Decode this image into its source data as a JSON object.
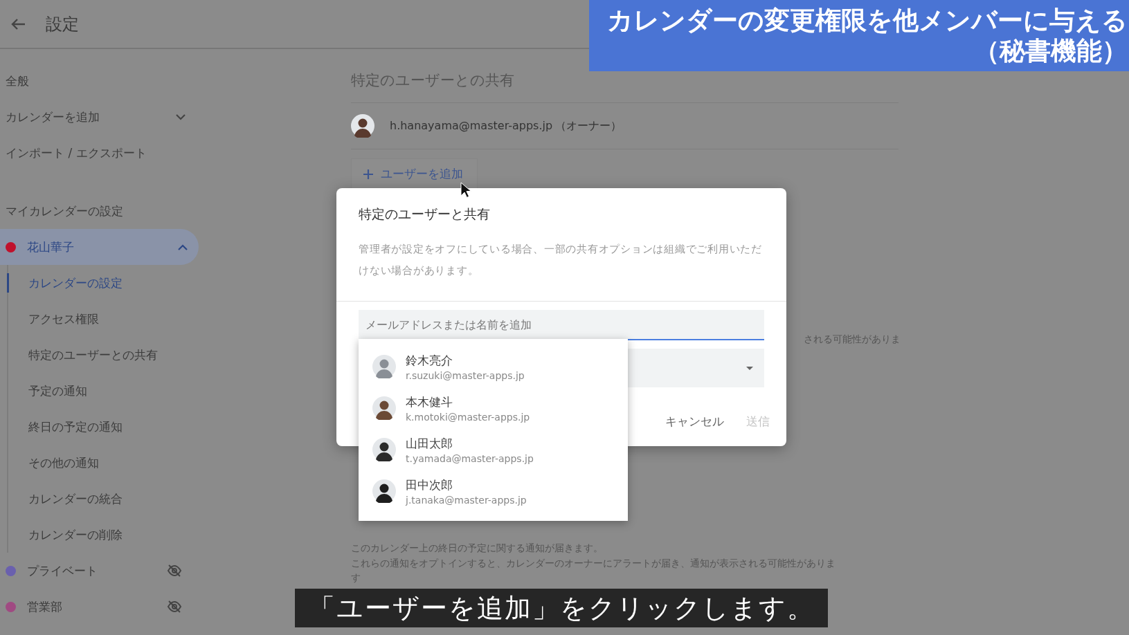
{
  "header": {
    "title": "設定"
  },
  "sidebar": {
    "items": [
      {
        "label": "全般",
        "kind": "link"
      },
      {
        "label": "カレンダーを追加",
        "kind": "expander",
        "expanded": false
      },
      {
        "label": "インポート / エクスポート",
        "kind": "link"
      }
    ],
    "section_title": "マイカレンダーの設定",
    "calendars": [
      {
        "name": "花山華子",
        "color": "#c0112c",
        "selected": true,
        "expanded": true,
        "hidden": false,
        "children": [
          {
            "label": "カレンダーの設定",
            "selected": true
          },
          {
            "label": "アクセス権限",
            "selected": false
          },
          {
            "label": "特定のユーザーとの共有",
            "selected": false
          },
          {
            "label": "予定の通知",
            "selected": false
          },
          {
            "label": "終日の予定の通知",
            "selected": false
          },
          {
            "label": "その他の通知",
            "selected": false
          },
          {
            "label": "カレンダーの統合",
            "selected": false
          },
          {
            "label": "カレンダーの削除",
            "selected": false
          }
        ]
      },
      {
        "name": "プライベート",
        "color": "#6a60ae",
        "selected": false,
        "hidden": true
      },
      {
        "name": "営業部",
        "color": "#a04a82",
        "selected": false,
        "hidden": true
      }
    ]
  },
  "sharing": {
    "heading": "特定のユーザーとの共有",
    "owner": {
      "email": "h.hanayama@master-apps.jp",
      "role": "（オーナー）"
    },
    "add_button": "ユーザーを追加"
  },
  "behind_text": "される可能性がありま",
  "all_day": {
    "lines": [
      "このカレンダー上の終日の予定に関する通知が届きます。",
      "これらの通知をオプトインすると、カレンダーのオーナーにアラートが届き、通知が表示される可能性がありま",
      "す"
    ]
  },
  "dialog": {
    "title": "特定のユーザーと共有",
    "description": "管理者が設定をオフにしている場合、一部の共有オプションは組織でご利用いただけない場合があります。",
    "input": {
      "placeholder": "メールアドレスまたは名前を追加"
    },
    "buttons": [
      {
        "label": "キャンセル",
        "disabled": false
      },
      {
        "label": "送信",
        "disabled": true
      }
    ]
  },
  "suggestions": [
    {
      "name": "鈴木亮介",
      "email": "r.suzuki@master-apps.jp"
    },
    {
      "name": "本木健斗",
      "email": "k.motoki@master-apps.jp"
    },
    {
      "name": "山田太郎",
      "email": "t.yamada@master-apps.jp"
    },
    {
      "name": "田中次郎",
      "email": "j.tanaka@master-apps.jp"
    }
  ],
  "banner": {
    "lines": [
      "カレンダーの変更権限を他メンバーに与える",
      "（秘書機能）"
    ]
  },
  "caption": "「ユーザーを追加」をクリックします。"
}
